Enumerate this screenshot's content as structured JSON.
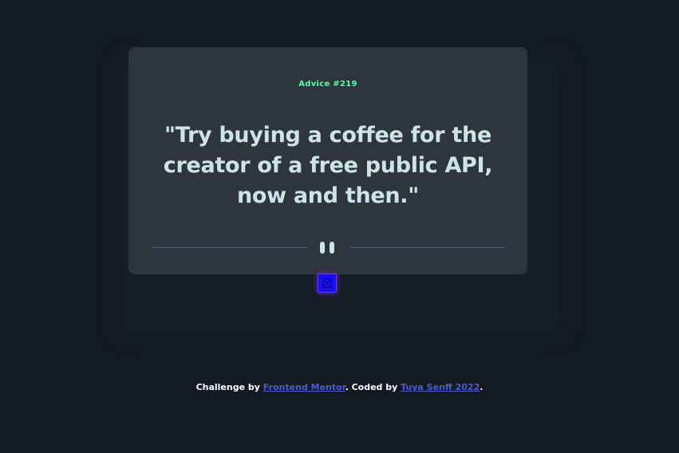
{
  "card": {
    "advice_label": "Advice #219",
    "quote": "\"Try buying a coffee for the creator of a free public API, now and then.\""
  },
  "dice_button": {
    "icon": "dice-icon",
    "color": "#1a0df0"
  },
  "divider": {
    "icon": "pause-icon"
  },
  "footer": {
    "challenge_prefix": "Challenge by ",
    "frontend_mentor_link": "Frontend Mentor",
    "coded_by_text": ". Coded by ",
    "author_link": "Tuya Senff 2022",
    "suffix": "."
  },
  "colors": {
    "background": "#141a23",
    "card": "#2e353f",
    "accent_green": "#52ffa8",
    "quote_text": "#cee3e9",
    "link": "#4d5bd0"
  }
}
